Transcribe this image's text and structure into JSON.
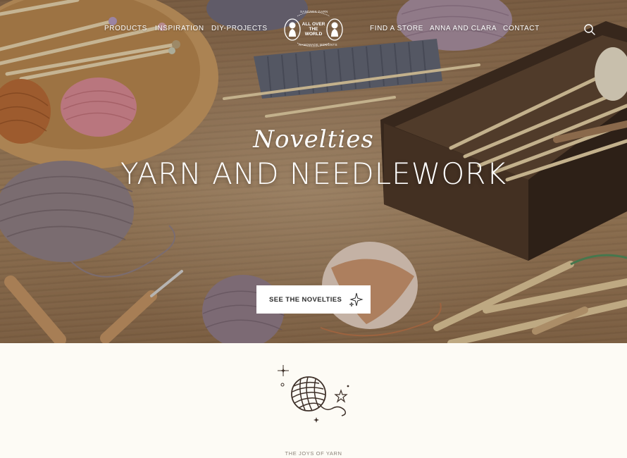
{
  "nav": {
    "left": [
      "PRODUCTS",
      "INSPIRATION",
      "DIY-PROJECTS"
    ],
    "right": [
      "FIND A STORE",
      "ANNA AND CLARA",
      "CONTACT"
    ]
  },
  "logo": {
    "center_text": "ALL OVER THE WORLD",
    "top_arc": "Sandnes Garn",
    "bottom_arc": "Handmade Moments"
  },
  "hero": {
    "script_title": "Novelties",
    "title": "YARN AND NEEDLEWORK",
    "cta_label": "SEE THE NOVELTIES"
  },
  "intro": {
    "eyebrow": "THE JOYS OF YARN"
  },
  "colors": {
    "background": "#fdfbf5",
    "wood": "#9c7b5a",
    "text_dark": "#2b2b2b",
    "illustration": "#3d2f28"
  }
}
